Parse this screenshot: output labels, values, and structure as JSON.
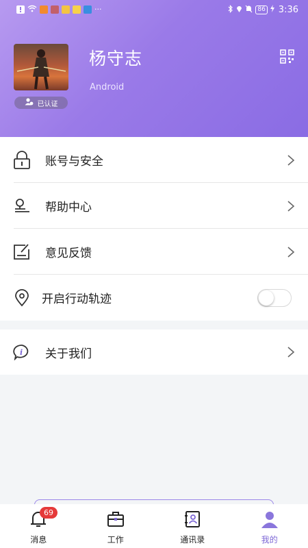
{
  "status_bar": {
    "time": "3:36",
    "battery": "86",
    "icons": [
      "alert-icon",
      "wifi-icon",
      "app-icon",
      "app-icon",
      "app-icon",
      "app-icon",
      "app-icon",
      "more-dots-icon",
      "bluetooth-icon",
      "location-icon",
      "mute-icon",
      "battery-icon",
      "charging-icon"
    ]
  },
  "profile": {
    "name": "杨守志",
    "subtitle": "Android",
    "verified_label": "已认证",
    "qr_icon": "qr-code-icon"
  },
  "menu": {
    "items": [
      {
        "label": "账号与安全",
        "icon": "lock-icon",
        "type": "link"
      },
      {
        "label": "帮助中心",
        "icon": "location-pin-icon",
        "type": "link"
      },
      {
        "label": "意见反馈",
        "icon": "edit-feedback-icon",
        "type": "link"
      },
      {
        "label": "开启行动轨迹",
        "icon": "map-pin-icon",
        "type": "toggle",
        "enabled": false
      }
    ]
  },
  "about": {
    "label": "关于我们",
    "icon": "info-bubble-icon"
  },
  "tabbar": {
    "tabs": [
      {
        "label": "消息",
        "icon": "bell-icon",
        "badge": "69",
        "active": false
      },
      {
        "label": "工作",
        "icon": "briefcase-icon",
        "active": false
      },
      {
        "label": "通讯录",
        "icon": "contacts-book-icon",
        "active": false
      },
      {
        "label": "我的",
        "icon": "person-icon",
        "active": true
      }
    ]
  },
  "colors": {
    "header_gradient_start": "#b79af0",
    "header_gradient_end": "#8a6ce4",
    "accent": "#7d67d6",
    "badge": "#e53a3a"
  }
}
